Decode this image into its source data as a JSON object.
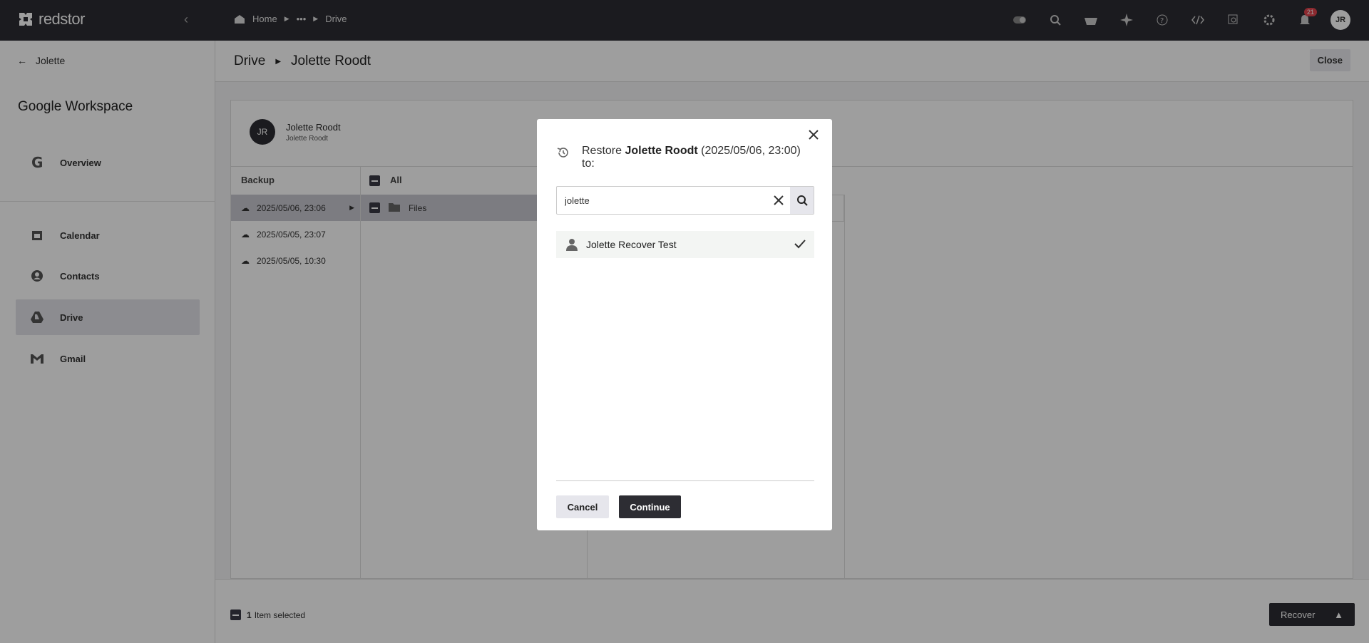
{
  "app": {
    "logo_text": "redstor"
  },
  "topbar": {
    "breadcrumbs": [
      "Home",
      "•••",
      "Drive"
    ],
    "notification_count": "21",
    "avatar_initials": "JR"
  },
  "sidebar": {
    "back_label": "Jolette",
    "section_title": "Google Workspace",
    "overview_label": "Overview",
    "items": [
      {
        "label": "Calendar",
        "icon": "calendar-icon"
      },
      {
        "label": "Contacts",
        "icon": "contacts-icon"
      },
      {
        "label": "Drive",
        "icon": "drive-icon",
        "active": true
      },
      {
        "label": "Gmail",
        "icon": "gmail-icon"
      }
    ]
  },
  "page_header": {
    "crumb_root": "Drive",
    "crumb_current": "Jolette Roodt",
    "close_label": "Close"
  },
  "user": {
    "initials": "JR",
    "name": "Jolette Roodt",
    "sub": "Jolette Roodt"
  },
  "backup_column": {
    "header": "Backup",
    "rows": [
      "2025/05/06, 23:06",
      "2025/05/05, 23:07",
      "2025/05/05, 10:30"
    ]
  },
  "files_column": {
    "header": "All",
    "rows": [
      "Files"
    ]
  },
  "footer": {
    "selected_count": "1",
    "selected_text": "Item selected",
    "recover_label": "Recover"
  },
  "modal": {
    "title_prefix": "Restore",
    "title_name": "Jolette Roodt",
    "title_suffix": "(2025/05/06, 23:00) to:",
    "search_value": "jolette",
    "result_label": "Jolette Recover Test",
    "cancel_label": "Cancel",
    "continue_label": "Continue"
  },
  "colors": {
    "topbar": "#2d2d33",
    "accent": "#2d2d33",
    "badge": "#e0434c"
  }
}
